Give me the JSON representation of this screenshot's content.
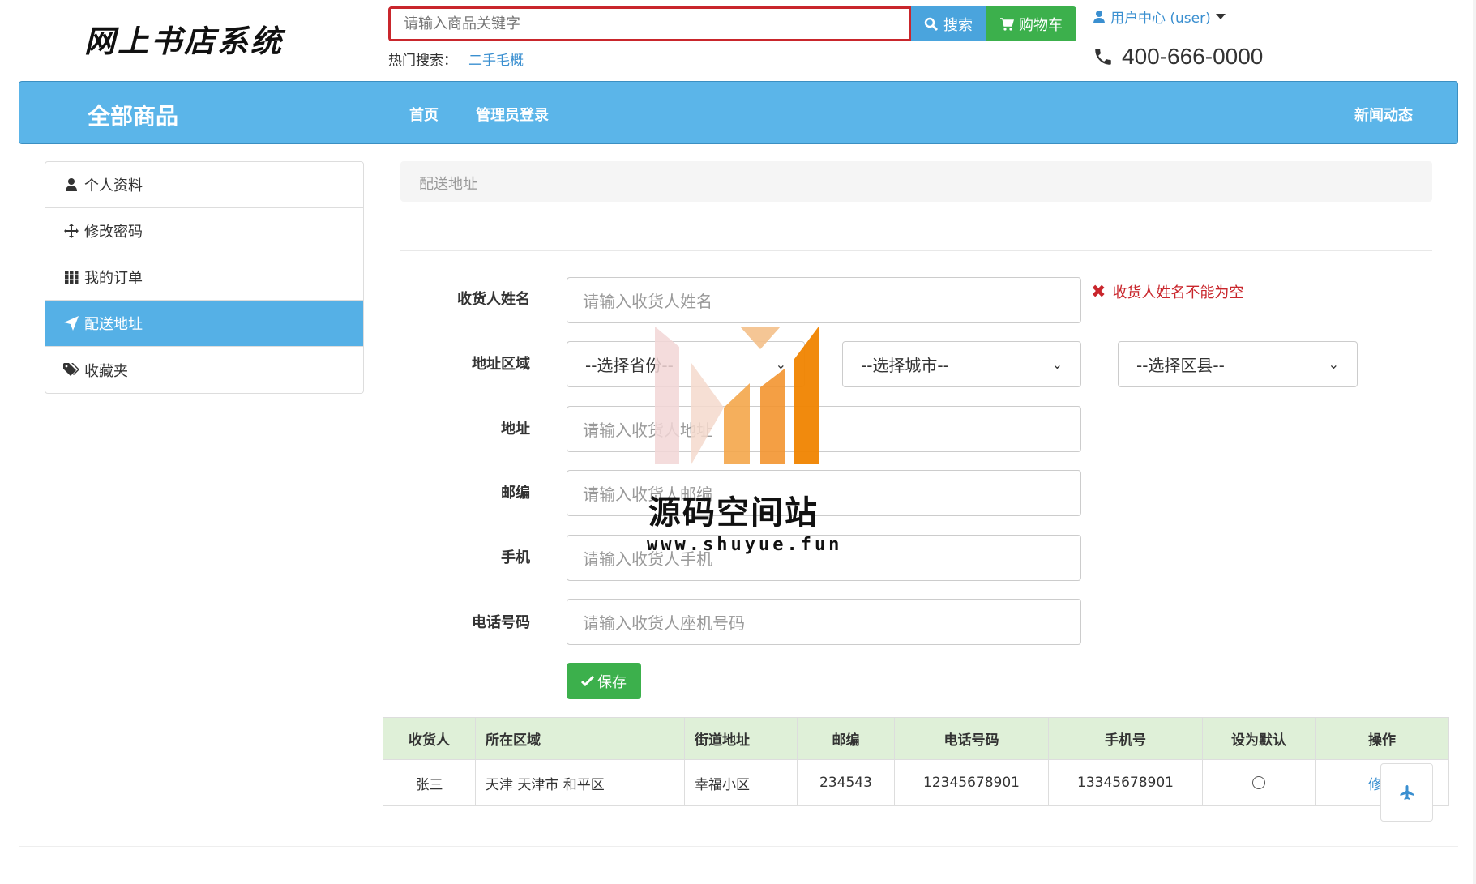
{
  "header": {
    "logo": "网上书店系统",
    "search_placeholder": "请输入商品关键字",
    "search_button": "搜索",
    "cart_button": "购物车",
    "hot_label": "热门搜索：",
    "hot_link": "二手毛概",
    "user_center": "用户中心 (user)",
    "phone": "400-666-0000"
  },
  "nav": {
    "brand": "全部商品",
    "home": "首页",
    "admin_login": "管理员登录",
    "news": "新闻动态"
  },
  "sidebar": {
    "items": [
      {
        "label": "个人资料",
        "icon": "user-icon",
        "active": false
      },
      {
        "label": "修改密码",
        "icon": "move-icon",
        "active": false
      },
      {
        "label": "我的订单",
        "icon": "grid-icon",
        "active": false
      },
      {
        "label": "配送地址",
        "icon": "send-icon",
        "active": true
      },
      {
        "label": "收藏夹",
        "icon": "tags-icon",
        "active": false
      }
    ]
  },
  "breadcrumb": "配送地址",
  "form": {
    "name_label": "收货人姓名",
    "name_placeholder": "请输入收货人姓名",
    "name_error": "收货人姓名不能为空",
    "region_label": "地址区域",
    "province_select": "--选择省份--",
    "city_select": "--选择城市--",
    "district_select": "--选择区县--",
    "address_label": "地址",
    "address_placeholder": "请输入收货人地址",
    "zip_label": "邮编",
    "zip_placeholder": "请输入收货人邮编",
    "mobile_label": "手机",
    "mobile_placeholder": "请输入收货人手机",
    "tel_label": "电话号码",
    "tel_placeholder": "请输入收货人座机号码",
    "save_button": "保存"
  },
  "table": {
    "headers": [
      "收货人",
      "所在区域",
      "街道地址",
      "邮编",
      "电话号码",
      "手机号",
      "设为默认",
      "操作"
    ],
    "rows": [
      {
        "name": "张三",
        "region": "天津 天津市 和平区",
        "street": "幸福小区",
        "zip": "234543",
        "tel": "12345678901",
        "mobile": "13345678901",
        "action": "修改"
      }
    ]
  },
  "watermark": {
    "title": "源码空间站",
    "url": "www.shuyue.fun"
  },
  "colors": {
    "primary": "#5bb5e9",
    "success": "#3cb04c",
    "danger": "#c9262c",
    "link": "#3a8fd0"
  }
}
